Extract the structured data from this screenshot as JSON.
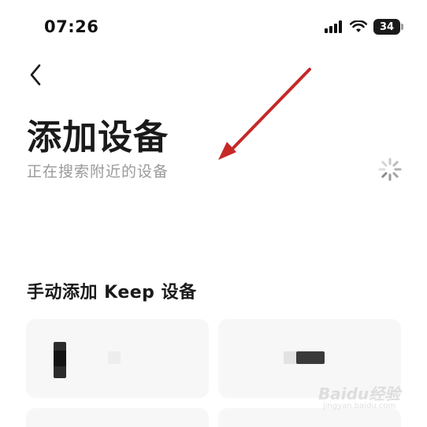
{
  "status_bar": {
    "time": "07:26",
    "battery": "34"
  },
  "header": {
    "back_icon": "chevron-left-icon",
    "title": "添加设备",
    "subtitle": "正在搜索附近的设备"
  },
  "manual_section": {
    "title": "手动添加 Keep 设备",
    "devices": [
      {
        "type": "band"
      },
      {
        "type": "tracker"
      },
      {
        "type": "more"
      },
      {
        "type": "more"
      }
    ]
  },
  "watermark": {
    "text": "Baidu经验",
    "sub": "jingyan.baidu.com"
  },
  "colors": {
    "accent_arrow": "#c62828",
    "card_bg": "#f7f7f7",
    "subtitle": "#9a9a9a"
  }
}
